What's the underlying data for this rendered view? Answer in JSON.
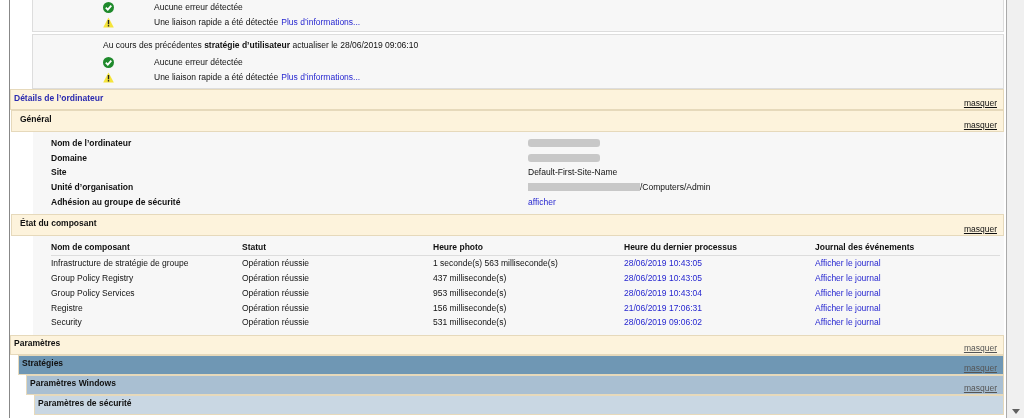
{
  "policy_blocks": [
    {
      "results": [
        {
          "kind": "ok",
          "text": "Aucune erreur détectée"
        },
        {
          "kind": "warning",
          "text": "Une liaison rapide a été détectée",
          "link": "Plus d’informations..."
        }
      ]
    },
    {
      "heading": "Au cours des précédentes **stratégie d’utilisateur** actualiser le 28/06/2019 09:06:10",
      "results": [
        {
          "kind": "ok",
          "text": "Aucune erreur détectée"
        },
        {
          "kind": "warning",
          "text": "Une liaison rapide a été détectée",
          "link": "Plus d’informations..."
        }
      ]
    }
  ],
  "computer_details": {
    "title": "Détails de l’ordinateur",
    "hide_link": "masquer",
    "general": {
      "title": "Général",
      "hide_link": "masquer",
      "fields": [
        {
          "label": "Nom de l’ordinateur",
          "kind": "redacted"
        },
        {
          "label": "Domaine",
          "kind": "redacted"
        },
        {
          "label": "Site",
          "kind": "text",
          "value": "Default-First-Site-Name"
        },
        {
          "label": "Unité d’organisation",
          "kind": "redacted_prefix",
          "value": "/Computers/Admin"
        },
        {
          "label": "Adhésion au groupe de sécurité",
          "kind": "link",
          "value": "afficher"
        }
      ]
    },
    "component_status": {
      "title": "État du composant",
      "hide_link": "masquer",
      "columns": [
        "Nom de composant",
        "Statut",
        "Heure photo",
        "Heure du dernier processus",
        "Journal des événements"
      ],
      "rows": [
        [
          "Infrastructure de stratégie de groupe",
          "Opération réussie",
          "1 seconde(s) 563 milliseconde(s)",
          "28/06/2019 10:43:05",
          "Afficher le journal"
        ],
        [
          "Group Policy Registry",
          "Opération réussie",
          "437 milliseconde(s)",
          "28/06/2019 10:43:05",
          "Afficher le journal"
        ],
        [
          "Group Policy Services",
          "Opération réussie",
          "953 milliseconde(s)",
          "28/06/2019 10:43:04",
          "Afficher le journal"
        ],
        [
          "Registre",
          "Opération réussie",
          "156 milliseconde(s)",
          "21/06/2019 17:06:31",
          "Afficher le journal"
        ],
        [
          "Security",
          "Opération réussie",
          "531 milliseconde(s)",
          "28/06/2019 09:06:02",
          "Afficher le journal"
        ]
      ]
    }
  },
  "settings": {
    "title": "Paramètres",
    "hide_link": "masquer",
    "children": [
      {
        "title": "Stratégies",
        "hide_link": "masquer",
        "children": [
          {
            "title": "Paramètres Windows",
            "hide_link": "masquer",
            "children": [
              {
                "title": "Paramètres de sécurité"
              }
            ]
          }
        ]
      }
    ]
  }
}
